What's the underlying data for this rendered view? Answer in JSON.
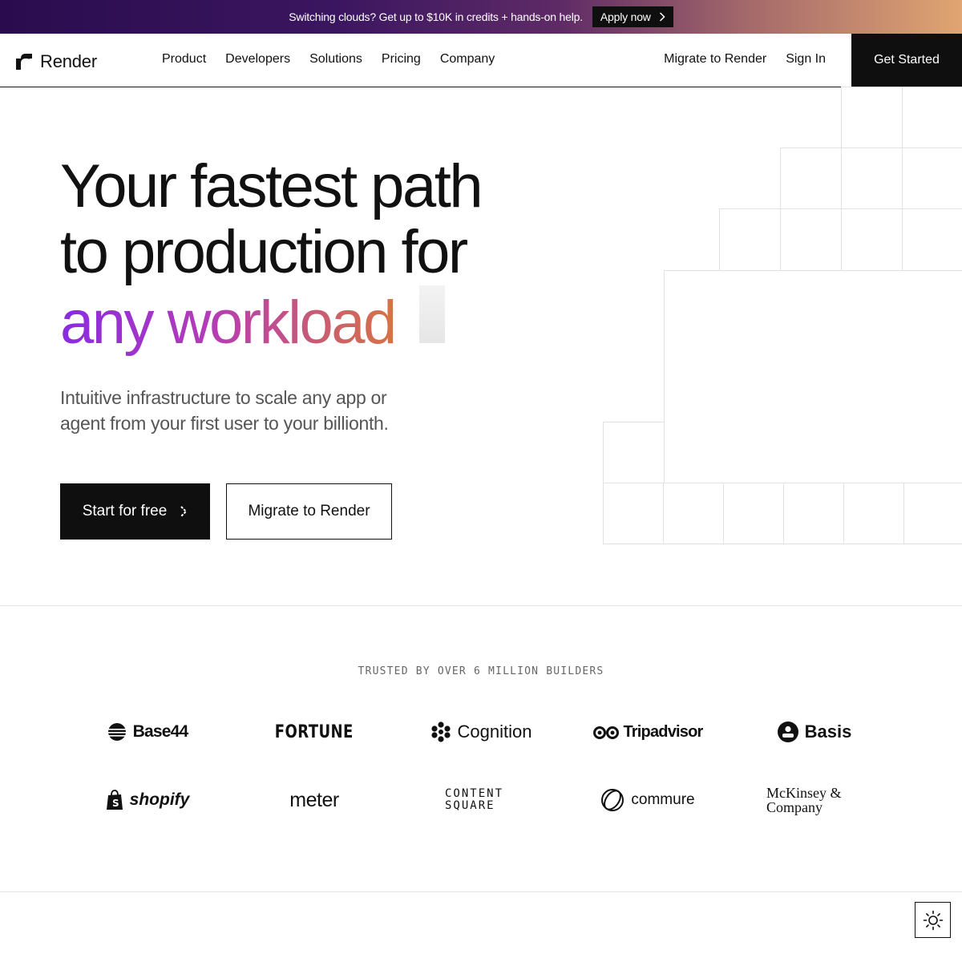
{
  "banner": {
    "text": "Switching clouds? Get up to $10K in credits + hands-on help.",
    "cta": "Apply now"
  },
  "nav": {
    "brand": "Render",
    "links": [
      "Product",
      "Developers",
      "Solutions",
      "Pricing",
      "Company"
    ],
    "migrate": "Migrate to Render",
    "sign_in": "Sign In",
    "cta": "Get Started"
  },
  "hero": {
    "title_line1": "Your fastest path",
    "title_line2": "to production for",
    "title_highlight": "any workload",
    "subtitle": "Intuitive infrastructure to scale any app or agent from your first user to your billionth.",
    "primary_cta": "Start for free",
    "secondary_cta": "Migrate to Render"
  },
  "trusted": {
    "heading": "TRUSTED BY OVER 6 MILLION BUILDERS",
    "logos_row1": [
      "Base44",
      "FORTUNE",
      "Cognition",
      "Tripadvisor",
      "Basis"
    ],
    "logos_row2": [
      "shopify",
      "meter",
      "CONTENT SQUARE",
      "commure",
      "McKinsey & Company"
    ]
  },
  "icons": {
    "brand": "render-logo-icon",
    "banner_arrow": "chevron-right-icon",
    "cta_arrow": "chevron-right-icon",
    "theme": "sun-icon"
  },
  "colors": {
    "banner_start": "#2a0c4e",
    "banner_end": "#e0a571",
    "highlight_start": "#8a2be2",
    "highlight_end": "#d77344",
    "primary": "#0f0f0f"
  }
}
